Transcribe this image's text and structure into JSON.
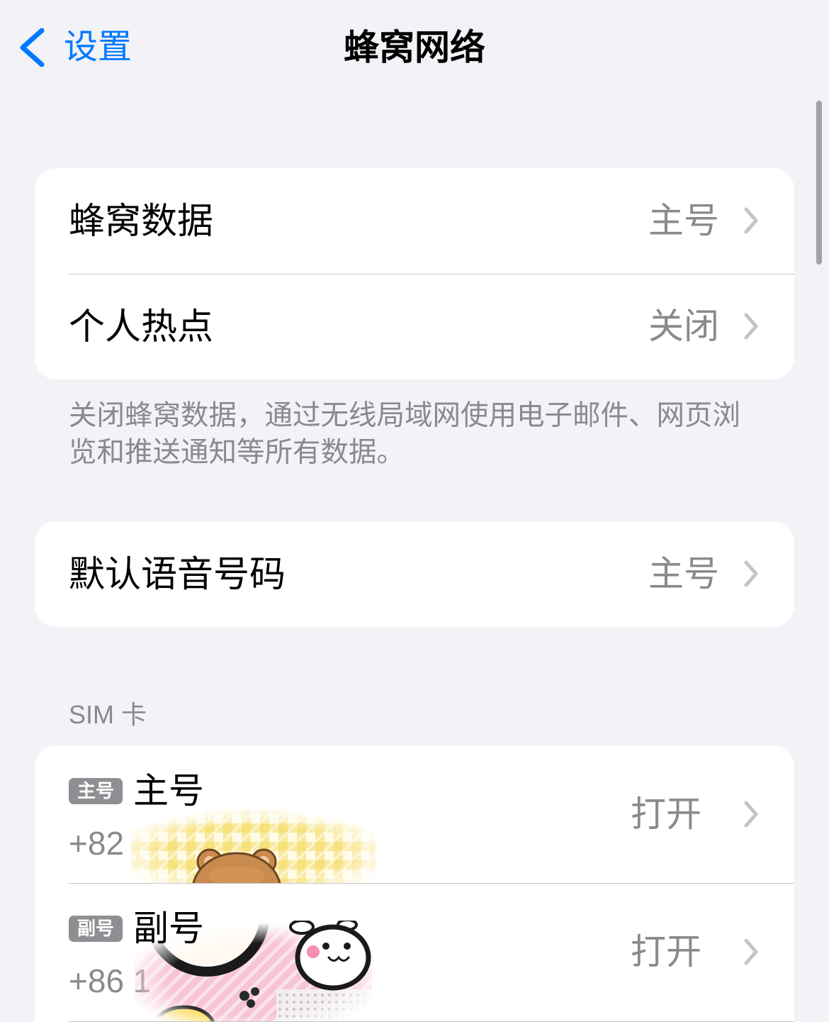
{
  "nav": {
    "back_label": "设置",
    "back_icon": "chevron-left-icon",
    "title": "蜂窝网络"
  },
  "cellular": {
    "rows": [
      {
        "label": "蜂窝数据",
        "value": "主号",
        "icon": "chevron-right-icon"
      },
      {
        "label": "个人热点",
        "value": "关闭",
        "icon": "chevron-right-icon"
      }
    ],
    "footer": "关闭蜂窝数据，通过无线局域网使用电子邮件、网页浏览和推送通知等所有数据。"
  },
  "voice": {
    "rows": [
      {
        "label": "默认语音号码",
        "value": "主号",
        "icon": "chevron-right-icon"
      }
    ]
  },
  "sim": {
    "header": "SIM 卡",
    "lines": [
      {
        "badge": "主号",
        "name": "主号",
        "number": "+82",
        "status": "打开",
        "icon": "chevron-right-icon"
      },
      {
        "badge": "副号",
        "name": "副号",
        "number": "+86 1",
        "status": "打开",
        "icon": "chevron-right-icon"
      }
    ]
  },
  "colors": {
    "accent": "#007AFF",
    "background": "#F2F2F7",
    "card": "#FFFFFF",
    "primary_text": "#000000",
    "secondary_text": "#8A8A8E",
    "separator": "#C6C6C8",
    "chevron": "#C4C4C7",
    "badge": "#8E8E93"
  }
}
